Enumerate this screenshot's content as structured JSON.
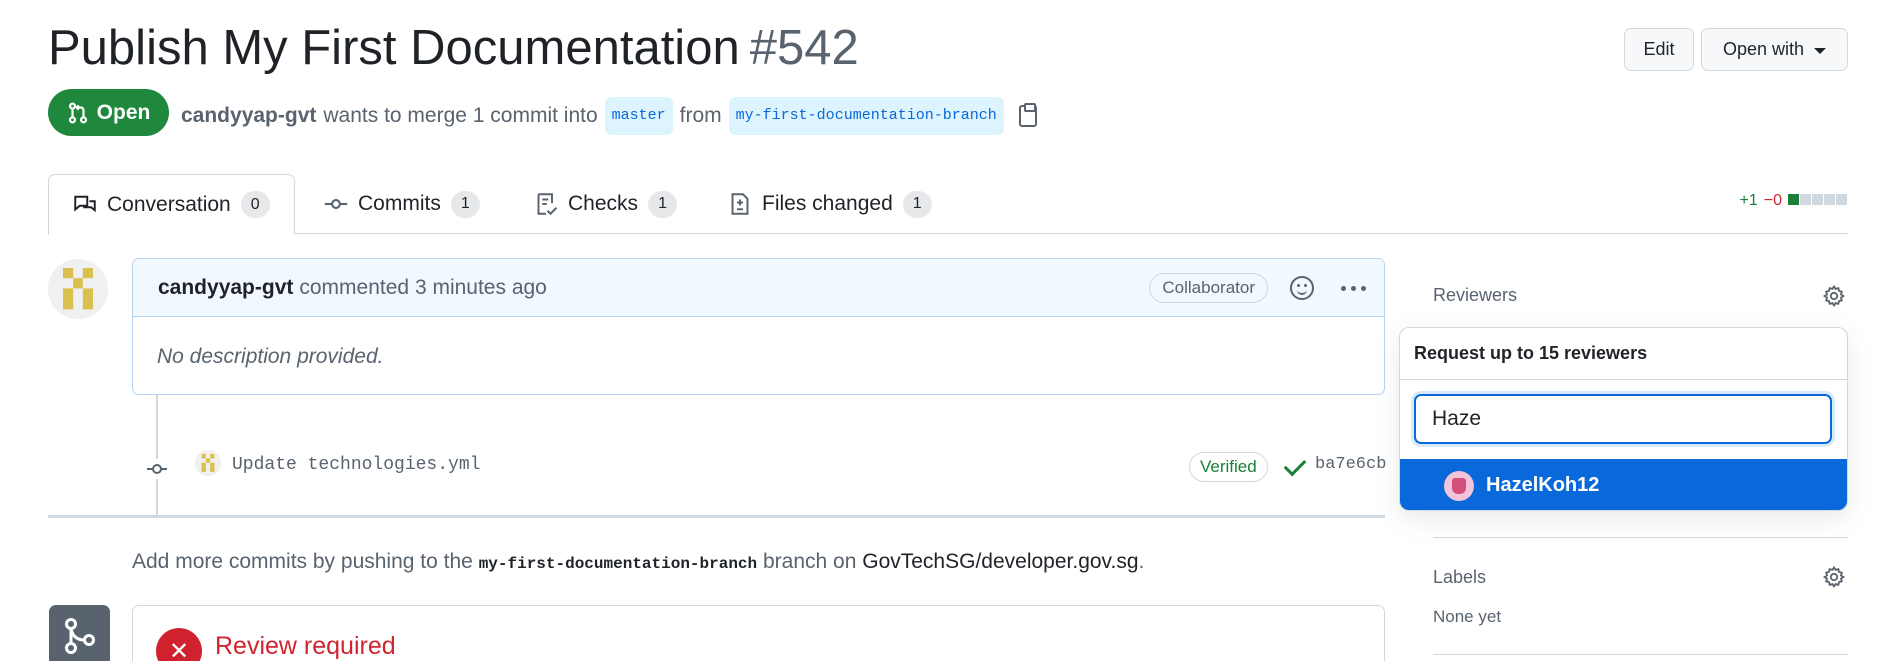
{
  "header": {
    "title": "Publish My First Documentation",
    "number": "#542",
    "edit_label": "Edit",
    "open_with_label": "Open with"
  },
  "status": {
    "state": "Open",
    "author": "candyyap-gvt",
    "summary": "wants to merge 1 commit into",
    "base_branch": "master",
    "from_word": "from",
    "head_branch": "my-first-documentation-branch"
  },
  "tabs": [
    {
      "label": "Conversation",
      "count": "0"
    },
    {
      "label": "Commits",
      "count": "1"
    },
    {
      "label": "Checks",
      "count": "1"
    },
    {
      "label": "Files changed",
      "count": "1"
    }
  ],
  "diffstat": {
    "added": "+1",
    "removed": "−0",
    "add_color": "#1a7f37",
    "del_color": "#d1242f"
  },
  "comment": {
    "author": "candyyap-gvt",
    "action": "commented",
    "time": "3 minutes ago",
    "role": "Collaborator",
    "body": "No description provided."
  },
  "commit": {
    "message": "Update technologies.yml",
    "verified": "Verified",
    "sha": "ba7e6cb"
  },
  "push_note": {
    "prefix": "Add more commits by pushing to the",
    "branch": "my-first-documentation-branch",
    "middle": "branch on",
    "repo": "GovTechSG/developer.gov.sg",
    "suffix": "."
  },
  "review": {
    "title": "Review required"
  },
  "sidebar": {
    "reviewers_label": "Reviewers",
    "popover_title": "Request up to 15 reviewers",
    "search_value": "Haze",
    "suggestion": "HazelKoh12",
    "labels_label": "Labels",
    "labels_value": "None yet"
  },
  "colors": {
    "accent": "#0969da",
    "open_green": "#1f883d",
    "danger": "#cf222e"
  }
}
